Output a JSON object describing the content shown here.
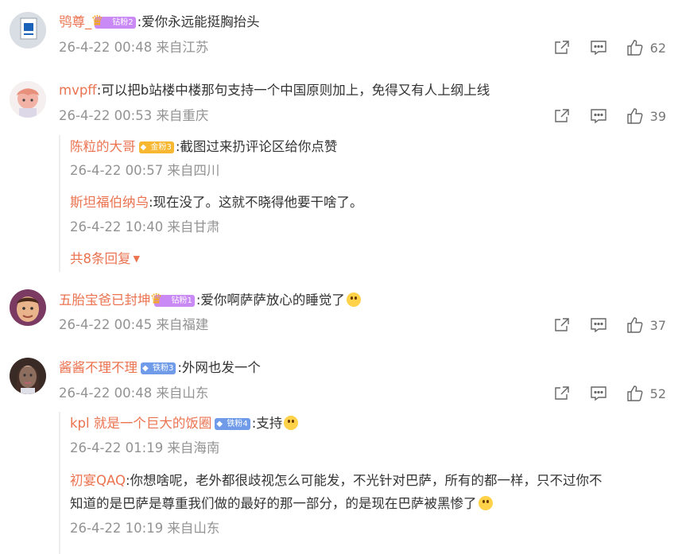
{
  "comments": [
    {
      "user": "鸮尊_",
      "badge": "钻粉2",
      "text": ":爱你永远能挺胸抬头",
      "meta": "26-4-22 00:48 来自江苏",
      "likes": "62"
    },
    {
      "user": "mvpff",
      "text": ":可以把b站楼中楼那句支持一个中国原则加上，免得又有人上纲上线",
      "meta": "26-4-22 00:53 来自重庆",
      "likes": "39",
      "replies": [
        {
          "user": "陈粒的大哥",
          "badge": "金粉3",
          "text": ":截图过来扔评论区给你点赞",
          "meta": "26-4-22 00:57 来自四川"
        },
        {
          "user": "斯坦福伯纳乌",
          "text": ":现在没了。这就不晓得他要干啥了。",
          "meta": "26-4-22 10:40 来自甘肃"
        }
      ],
      "more": "共8条回复"
    },
    {
      "user": "五胎宝爸已封坤",
      "badge": "钻粉1",
      "text": ":爱你啊萨萨放心的睡觉了",
      "meta": "26-4-22 00:45 来自福建",
      "likes": "37"
    },
    {
      "user": "酱酱不理不理",
      "badge": "铁粉3",
      "text": ":外网也发一个",
      "meta": "26-4-22 00:48 来自山东",
      "likes": "52",
      "replies": [
        {
          "user": "kpl 就是一个巨大的饭圈",
          "badge": "铁粉4",
          "text": ":支持",
          "meta": "26-4-22 01:19 来自海南"
        },
        {
          "user": "初宴QAQ",
          "text": ":你想啥呢，老外都很歧视怎么可能发，不光针对巴萨，所有的都一样，只不过你不",
          "text2": "知道的是巴萨是尊重我们做的最好的那一部分，的是现在巴萨被黑惨了",
          "meta": "26-4-22 10:19 来自山东"
        }
      ]
    }
  ],
  "colors": {
    "name": "#eb7350",
    "meta": "#939393",
    "text": "#333333"
  },
  "icons": [
    "share-icon",
    "comment-icon",
    "like-icon"
  ]
}
